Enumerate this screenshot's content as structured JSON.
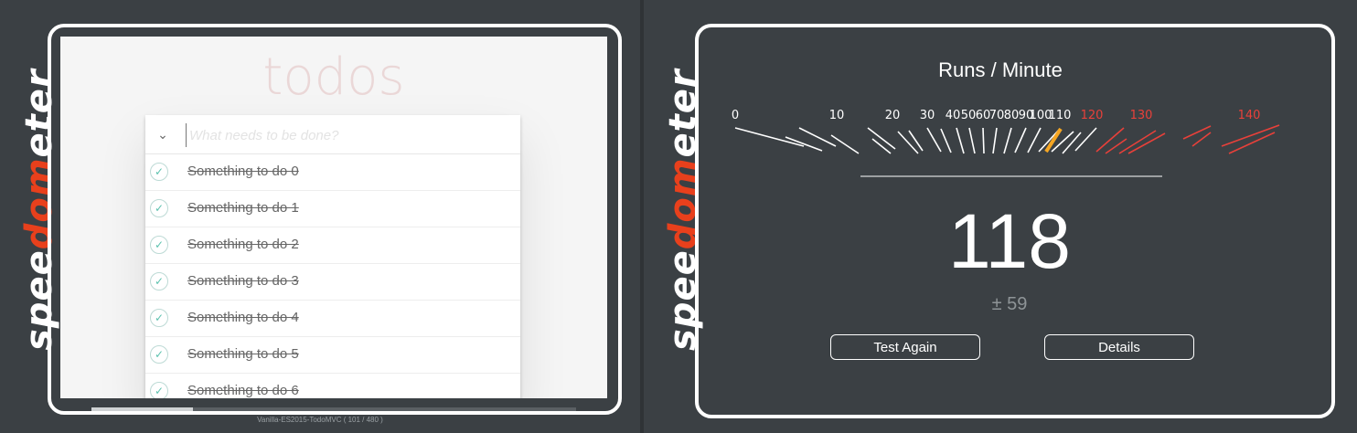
{
  "logo": {
    "prefix": "spee",
    "accent": "dom",
    "suffix": "eter",
    "accent_color": "#e8401c"
  },
  "todo_app": {
    "title": "todos",
    "input_placeholder": "What needs to be done?",
    "items": [
      {
        "label": "Something to do 0",
        "completed": true
      },
      {
        "label": "Something to do 1",
        "completed": true
      },
      {
        "label": "Something to do 2",
        "completed": true
      },
      {
        "label": "Something to do 3",
        "completed": true
      },
      {
        "label": "Something to do 4",
        "completed": true
      },
      {
        "label": "Something to do 5",
        "completed": true
      },
      {
        "label": "Something to do 6",
        "completed": true
      }
    ]
  },
  "status": {
    "text": "Vanilla-ES2015-TodoMVC ( 101 / 480 )",
    "progress_fraction": 0.21
  },
  "results": {
    "title": "Runs / Minute",
    "score": "118",
    "error": "± 59",
    "buttons": {
      "test_again": "Test Again",
      "details": "Details"
    }
  },
  "gauge": {
    "labels": [
      "0",
      "10",
      "20",
      "30",
      "40",
      "50",
      "60",
      "70",
      "80",
      "90",
      "100",
      "110",
      "120",
      "130",
      "140"
    ],
    "red_from": 120,
    "needle_value": 95,
    "colors": {
      "tick": "#ffffff",
      "red": "#e8403a",
      "needle": "#f5a623"
    }
  }
}
